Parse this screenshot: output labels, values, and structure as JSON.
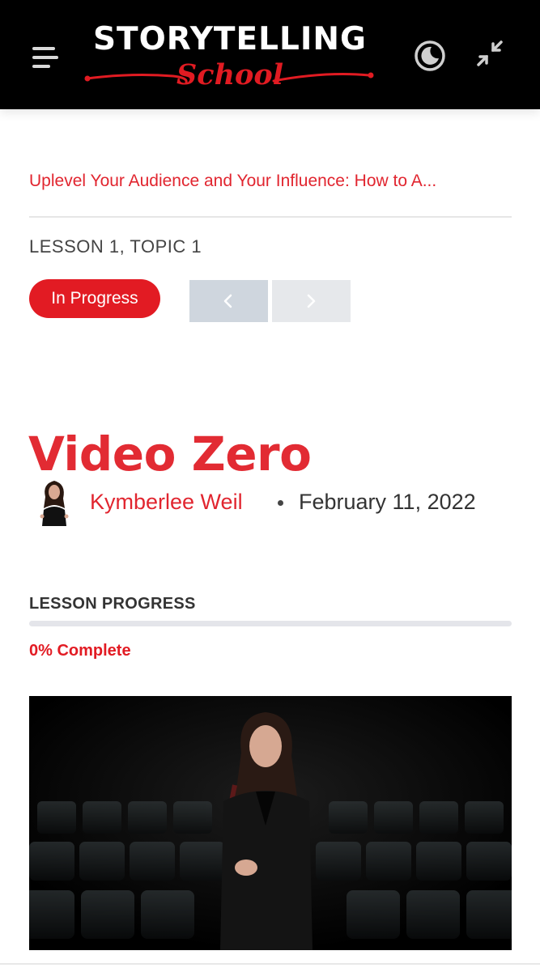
{
  "header": {
    "brand_top": "STORYTELLING",
    "brand_bottom": "School",
    "icons": {
      "menu": "hamburger-menu-icon",
      "theme": "moon-icon",
      "collapse": "collapse-arrows-icon"
    }
  },
  "course": {
    "breadcrumb": "Uplevel Your Audience and Your Influence: How to A...",
    "lesson_label": "LESSON 1, TOPIC 1",
    "status": "In Progress"
  },
  "lesson": {
    "title": "Video Zero",
    "author": "Kymberlee Weil",
    "date": "February 11, 2022"
  },
  "progress": {
    "label": "LESSON PROGRESS",
    "percent": 0,
    "text": "0% Complete"
  },
  "colors": {
    "accent": "#e21b23",
    "header_bg": "#000000"
  }
}
